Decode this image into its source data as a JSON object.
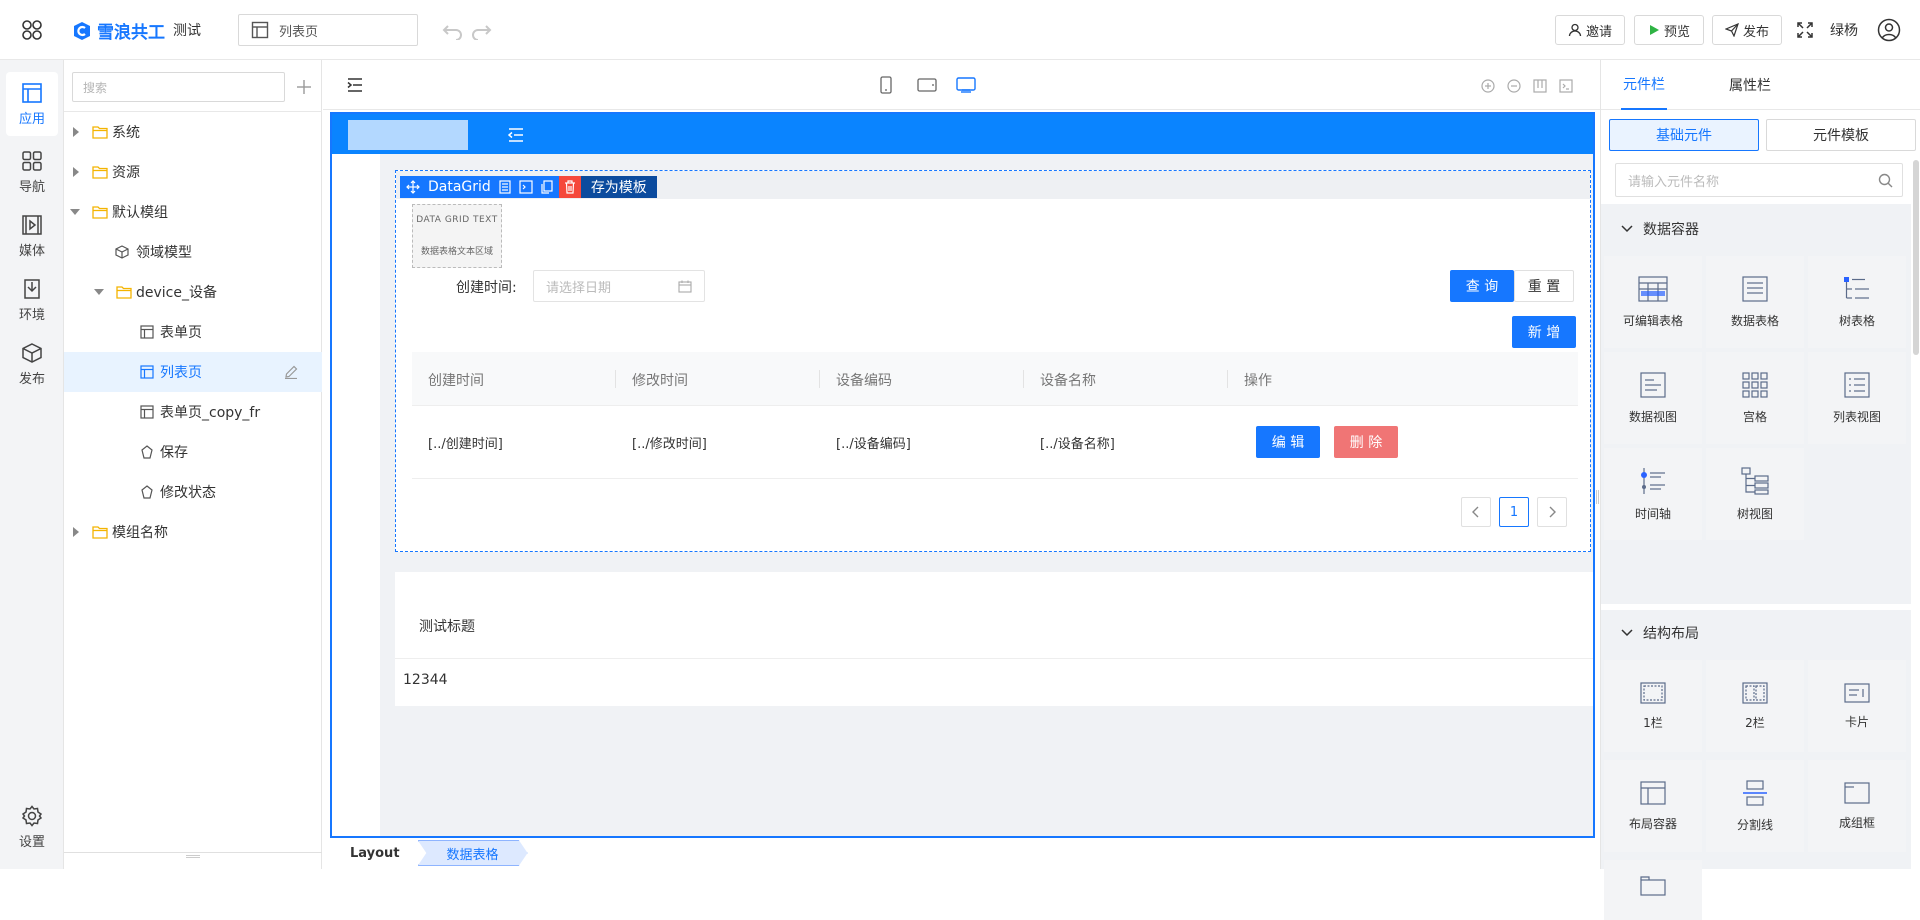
{
  "header": {
    "brand": "雪浪共工",
    "project": "测试",
    "page_selector": "列表页",
    "invite": "邀请",
    "preview": "预览",
    "publish": "发布",
    "user": "绿杨"
  },
  "rail": {
    "items": [
      {
        "label": "应用",
        "icon": "app-icon"
      },
      {
        "label": "导航",
        "icon": "grid-icon"
      },
      {
        "label": "媒体",
        "icon": "media-icon"
      },
      {
        "label": "环境",
        "icon": "env-icon"
      },
      {
        "label": "发布",
        "icon": "box-icon"
      }
    ],
    "settings": "设置"
  },
  "tree": {
    "search_placeholder": "搜索",
    "items": [
      {
        "label": "系统"
      },
      {
        "label": "资源"
      },
      {
        "label": "默认模组"
      },
      {
        "label": "领域模型"
      },
      {
        "label": "device_设备"
      },
      {
        "label": "表单页"
      },
      {
        "label": "列表页"
      },
      {
        "label": "表单页_copy_fr"
      },
      {
        "label": "保存"
      },
      {
        "label": "修改状态"
      },
      {
        "label": "模组名称"
      }
    ]
  },
  "canvas": {
    "datagrid": {
      "name": "DataGrid",
      "save_template": "存为模板",
      "text_line1": "DATA GRID TEXT",
      "text_line2": "数据表格文本区域",
      "filter_label": "创建时间:",
      "date_placeholder": "请选择日期",
      "query": "查 询",
      "reset": "重 置",
      "add": "新 增",
      "columns": [
        "创建时间",
        "修改时间",
        "设备编码",
        "设备名称",
        "操作"
      ],
      "row": [
        "[../创建时间]",
        "[../修改时间]",
        "[../设备编码]",
        "[../设备名称]"
      ],
      "edit": "编 辑",
      "delete": "删 除",
      "page": "1"
    },
    "card_title": "测试标题",
    "card_value": "12344",
    "breadcrumb": [
      "Layout",
      "数据表格"
    ]
  },
  "right": {
    "tabs": [
      "元件栏",
      "属性栏"
    ],
    "subtabs": [
      "基础元件",
      "元件模板"
    ],
    "search_placeholder": "请输入元件名称",
    "section1": "数据容器",
    "section1_items": [
      "可编辑表格",
      "数据表格",
      "树表格",
      "数据视图",
      "宫格",
      "列表视图",
      "时间轴",
      "树视图"
    ],
    "section2": "结构布局",
    "section2_items": [
      "1栏",
      "2栏",
      "卡片",
      "布局容器",
      "分割线",
      "成组框"
    ]
  },
  "colors": {
    "primary": "#1677ff",
    "header_blue": "#0a84ff",
    "danger": "#f07575",
    "selected_bg": "#e8f3ff"
  }
}
